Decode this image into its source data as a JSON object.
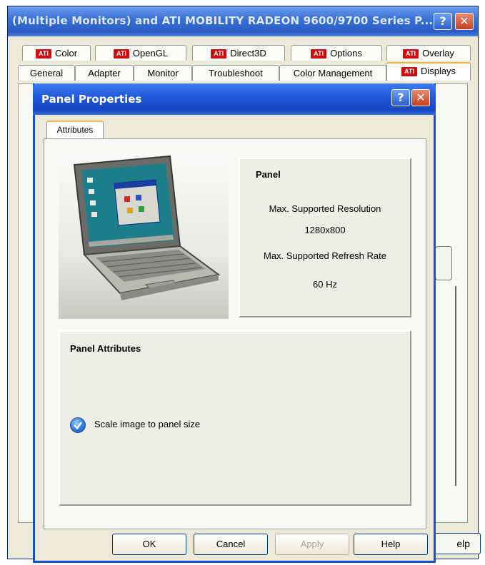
{
  "outer_window": {
    "title": "(Multiple Monitors) and ATI MOBILITY RADEON 9600/9700 Series P...",
    "help_glyph": "?",
    "close_glyph": "✕",
    "tabs_row1": [
      "Color",
      "OpenGL",
      "Direct3D",
      "Options",
      "Overlay"
    ],
    "tabs_row2": [
      "General",
      "Adapter",
      "Monitor",
      "Troubleshoot",
      "Color Management",
      "Displays"
    ],
    "ati_badge": "ATI",
    "help_button_partial": "elp"
  },
  "dialog": {
    "title": "Panel Properties",
    "help_glyph": "?",
    "close_glyph": "✕",
    "tab": "Attributes",
    "panel": {
      "title": "Panel",
      "max_res_label": "Max. Supported Resolution",
      "max_res_value": "1280x800",
      "max_refresh_label": "Max. Supported Refresh Rate",
      "max_refresh_value": "60 Hz"
    },
    "attributes": {
      "title": "Panel Attributes",
      "scale_label": "Scale image to panel size",
      "scale_checked": true
    },
    "buttons": {
      "ok": "OK",
      "cancel": "Cancel",
      "apply": "Apply",
      "help": "Help"
    }
  },
  "colors": {
    "titlebar": "#1f58d8",
    "ati_red": "#d10a10",
    "tab_highlight": "#f3b540",
    "close_red": "#c8401f"
  }
}
